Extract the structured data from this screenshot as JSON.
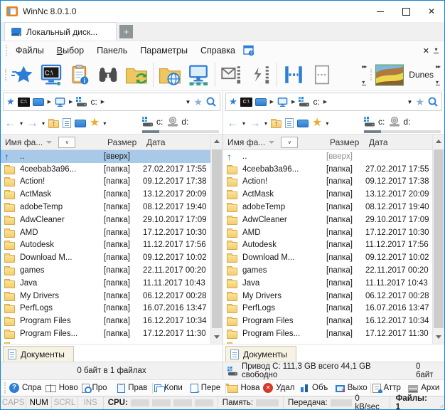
{
  "window": {
    "title": "WinNc 8.0.1.0"
  },
  "tabs": {
    "active_label": "Локальный диск...",
    "new_tab_label": "+"
  },
  "menu": {
    "items": [
      "Файлы",
      "Выбор",
      "Панель",
      "Параметры",
      "Справка"
    ]
  },
  "toolbar": {
    "theme_label": "Dunes",
    "icons": [
      "favorites-star",
      "dos-prompt",
      "clipboard-info",
      "search-binoculars",
      "folder-sync",
      "folder-web",
      "network-pc",
      "zip-mail",
      "zip-quick",
      "split-files",
      "empty-file"
    ]
  },
  "icons": {
    "dos_label": "C:\\"
  },
  "drives": {
    "c": "c:",
    "d": "d:"
  },
  "list": {
    "columns": {
      "name": "Имя фа...",
      "size": "Размер",
      "date": "Дата"
    }
  },
  "files": [
    {
      "icon": "up",
      "name": "..",
      "size": "[вверх]",
      "date": ""
    },
    {
      "icon": "folder",
      "name": "4ceebab3a96...",
      "size": "[папка]",
      "date": "27.02.2017 17:55"
    },
    {
      "icon": "folder",
      "name": "Action!",
      "size": "[папка]",
      "date": "09.12.2017 17:38"
    },
    {
      "icon": "folder",
      "name": "ActMask",
      "size": "[папка]",
      "date": "13.12.2017 20:09"
    },
    {
      "icon": "folder",
      "name": "adobeTemp",
      "size": "[папка]",
      "date": "08.12.2017 19:40"
    },
    {
      "icon": "folder",
      "name": "AdwCleaner",
      "size": "[папка]",
      "date": "29.10.2017 17:09"
    },
    {
      "icon": "folder",
      "name": "AMD",
      "size": "[папка]",
      "date": "17.12.2017 10:30"
    },
    {
      "icon": "folder",
      "name": "Autodesk",
      "size": "[папка]",
      "date": "11.12.2017 17:56"
    },
    {
      "icon": "folder",
      "name": "Download M...",
      "size": "[папка]",
      "date": "09.12.2017 10:02"
    },
    {
      "icon": "folder",
      "name": "games",
      "size": "[папка]",
      "date": "22.11.2017 00:20"
    },
    {
      "icon": "folder",
      "name": "Java",
      "size": "[папка]",
      "date": "11.11.2017 10:43"
    },
    {
      "icon": "folder",
      "name": "My Drivers",
      "size": "[папка]",
      "date": "06.12.2017 00:28"
    },
    {
      "icon": "folder",
      "name": "PerfLogs",
      "size": "[папка]",
      "date": "16.07.2016 13:47"
    },
    {
      "icon": "folder",
      "name": "Program Files",
      "size": "[папка]",
      "date": "16.12.2017 10:34"
    },
    {
      "icon": "folder",
      "name": "Program Files...",
      "size": "[папка]",
      "date": "17.12.2017 11:30"
    },
    {
      "icon": "folder",
      "name": "",
      "size": "",
      "date": ""
    }
  ],
  "panels": {
    "left": {
      "selected_index": 0,
      "docs_tab": "Документы",
      "status": "0 байт в 1 файлах"
    },
    "right": {
      "selected_index": -1,
      "docs_tab": "Документы",
      "status_drive": "Привод C: 111,3 GB всего 44,1 GB свободно",
      "status_bytes": "0 байт"
    }
  },
  "function_bar": {
    "items": [
      {
        "label": "Спра"
      },
      {
        "label": "Ново"
      },
      {
        "label": "Про"
      },
      {
        "label": "Прав"
      },
      {
        "label": "Копи"
      },
      {
        "label": "Пере"
      },
      {
        "label": "Нова"
      },
      {
        "label": "Удал"
      },
      {
        "label": "Объ"
      },
      {
        "label": "Выхо"
      },
      {
        "label": "Аттр"
      },
      {
        "label": "Архи"
      }
    ]
  },
  "status_bar": {
    "caps": "CAPS",
    "num": "NUM",
    "scrl": "SCRL",
    "ins": "INS",
    "cpu_label": "CPU:",
    "memory_label": "Память:",
    "transfer_label": "Передача:",
    "speed": "0 kB/sec",
    "files_count": "Файлы: 1"
  },
  "colors": {
    "accent": "#2c7dd4",
    "selection": "#a9c9e9",
    "folder_fill": "#f2cd6e",
    "window_border": "#1883d7"
  }
}
